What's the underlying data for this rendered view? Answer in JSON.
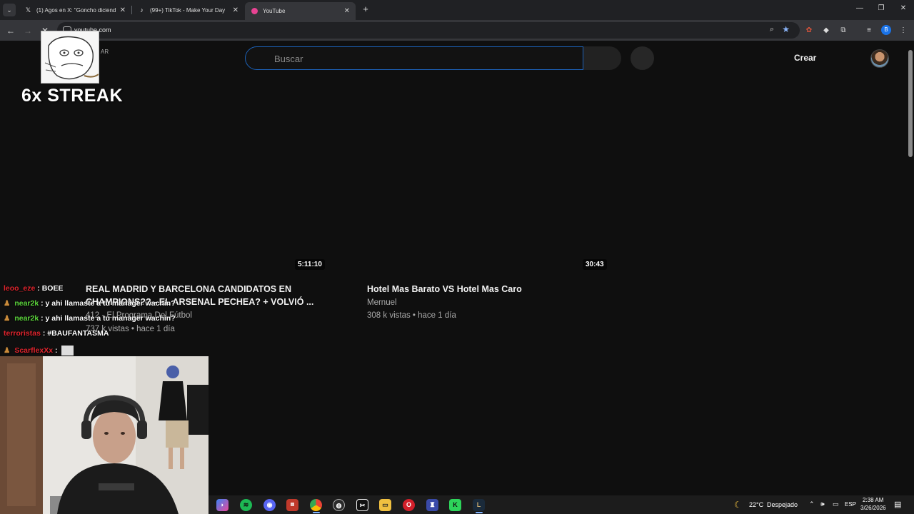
{
  "browser": {
    "tabs": [
      {
        "title": "(1) Agos en X: \"Goncho diciendo",
        "icon": "x-logo-icon",
        "active": false
      },
      {
        "title": "(99+) TikTok - Make Your Day",
        "icon": "tiktok-icon",
        "active": false
      },
      {
        "title": "YouTube",
        "icon": "youtube-icon",
        "active": true
      }
    ],
    "tab_search_icon": "⌄",
    "new_tab_icon": "+",
    "url": "youtube.com",
    "profile_initial": "B"
  },
  "youtube": {
    "search_placeholder": "Buscar",
    "create_label": "Crear"
  },
  "streak_overlay": {
    "side_text": "AR",
    "label": "6x STREAK"
  },
  "videos": [
    {
      "duration": "5:11:10",
      "title_line1": "REAL MADRID Y BARCELONA CANDIDATOS EN",
      "title_line2": "CHAMPIONS?? - EL ARSENAL PECHEA? + VOLVIÓ ...",
      "channel": "412 - El Programa Del Fútbol",
      "meta": "737 k vistas • hace 1 día"
    },
    {
      "duration": "30:43",
      "title_line1": "Hotel Mas Barato VS Hotel Mas Caro",
      "title_line2": "",
      "channel": "Mernuel",
      "meta": "308 k vistas • hace 1 día"
    }
  ],
  "chat": [
    {
      "user": "leoo_eze",
      "color": "#e0242d",
      "message": "BOEE",
      "badge": false
    },
    {
      "user": "near2k",
      "color": "#5cd63c",
      "message": "y ahi llamaste a tu manager wachin?",
      "badge": true
    },
    {
      "user": "near2k",
      "color": "#5cd63c",
      "message": "y ahi llamaste a tu manager wachin?",
      "badge": true
    },
    {
      "user": "terroristas",
      "color": "#e0242d",
      "message": "#BAUFANTASMA",
      "badge": false
    },
    {
      "user": "ScarflexXx",
      "color": "#e0242d",
      "message": "",
      "badge": true
    }
  ],
  "taskbar": {
    "weather_temp": "22°C",
    "weather_text": "Despejado",
    "language": "ESP",
    "time": "2:38 AM",
    "date": "3/26/2026",
    "apps": [
      "copilot-icon",
      "spotify-icon",
      "discord-icon",
      "voice-app-icon",
      "chrome-icon",
      "obs-icon",
      "capcut-icon",
      "file-explorer-icon",
      "opera-icon",
      "game-icon",
      "kick-icon",
      "league-icon"
    ]
  }
}
